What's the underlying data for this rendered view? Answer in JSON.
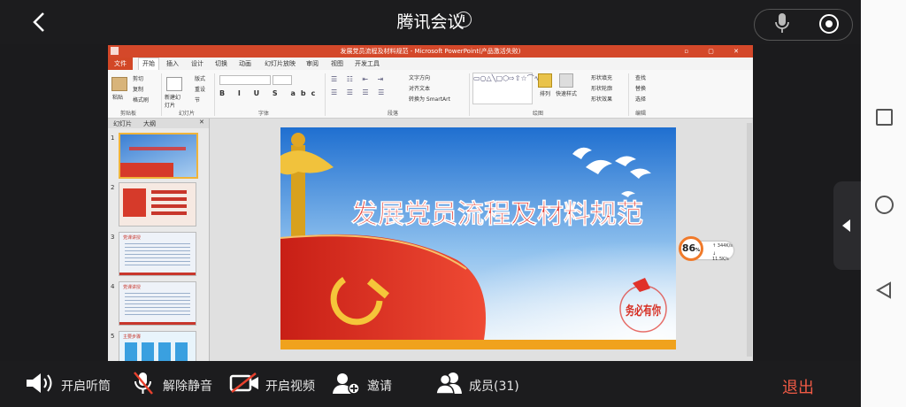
{
  "topbar": {
    "title": "腾讯会议",
    "info_symbol": "i"
  },
  "bottombar": {
    "speaker_label": "开启听筒",
    "unmute_label": "解除静音",
    "video_label": "开启视频",
    "invite_label": "邀请",
    "members_label": "成员(31)",
    "exit_label": "退出"
  },
  "ppt": {
    "window_title": "发展党员流程及材料规范 - Microsoft PowerPoint(产品激活失败)",
    "tabs": [
      "文件",
      "开始",
      "插入",
      "设计",
      "切换",
      "动画",
      "幻灯片放映",
      "审阅",
      "视图",
      "开发工具"
    ],
    "groups": {
      "clipboard": "剪贴板",
      "slides": "幻灯片",
      "font": "字体",
      "paragraph": "段落",
      "drawing": "绘图",
      "editing": "编辑"
    },
    "ribbon_items": {
      "paste": "粘贴",
      "cut": "剪切",
      "copy": "复制",
      "format_painter": "格式刷",
      "new_slide": "新建幻灯片",
      "layout": "版式",
      "reset": "重设",
      "section": "节",
      "text_direction": "文字方向",
      "align_text": "对齐文本",
      "smartart": "转换为 SmartArt",
      "arrange": "排列",
      "quick_styles": "快速样式",
      "shape_fill": "形状填充",
      "shape_outline": "形状轮廓",
      "shape_effects": "形状效果",
      "find": "查找",
      "replace": "替换",
      "select": "选择"
    },
    "panel_tabs": [
      "幻灯片",
      "大纲"
    ],
    "thumb_numbers": [
      "1",
      "2",
      "3",
      "4",
      "5"
    ],
    "thumb_titles": [
      "",
      "",
      "党课讲授",
      "党课讲授",
      "主要步骤"
    ],
    "slide_title": "发展党员流程及材料规范",
    "stamp_text": "务必有你"
  },
  "speed_widget": {
    "percent": "86",
    "unit": "%",
    "up": "344K/s",
    "down": "11.5K/s"
  },
  "colors": {
    "exit": "#f05a45",
    "ppt_title": "#d4482a",
    "slide_title": "#e0322a"
  }
}
